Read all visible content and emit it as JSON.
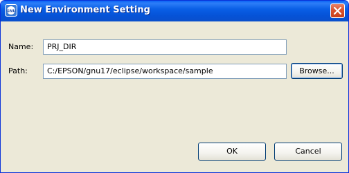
{
  "window": {
    "title": "New Environment Setting",
    "icon": "gnu-app-icon",
    "close_icon": "close-icon"
  },
  "form": {
    "name_label": "Name:",
    "name_value": "PRJ_DIR",
    "path_label": "Path:",
    "path_value": "C:/EPSON/gnu17/eclipse/workspace/sample",
    "browse_label": "Browse..."
  },
  "buttons": {
    "ok_label": "OK",
    "cancel_label": "Cancel"
  },
  "colors": {
    "titlebar": "#0553d8",
    "close_button": "#d9522e",
    "dialog_background": "#ece9d8",
    "field_border": "#7f9db9",
    "button_border": "#003c74"
  }
}
